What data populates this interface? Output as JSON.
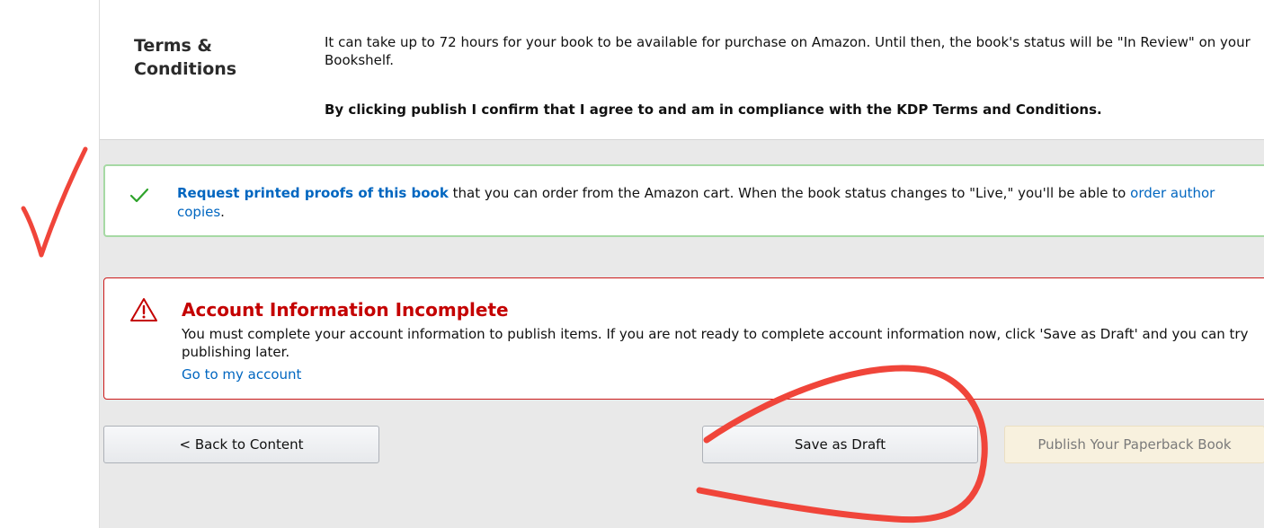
{
  "terms": {
    "heading": "Terms & Conditions",
    "body": "It can take up to 72 hours for your book to be available for purchase on Amazon. Until then, the book's status will be \"In Review\" on your Bookshelf.",
    "confirm": "By clicking publish I confirm that I agree to and am in compliance with the KDP Terms and Conditions."
  },
  "proofs": {
    "icon": "checkmark-icon",
    "link_text": "Request printed proofs of this book",
    "middle_text": " that you can order from the Amazon cart. When the book status changes to \"Live,\" you'll be able to ",
    "author_link_text": "order author copies",
    "end_text": "."
  },
  "account_alert": {
    "icon": "warning-triangle-icon",
    "title": "Account Information Incomplete",
    "body": "You must complete your account information to publish items. If you are not ready to complete account information now, click 'Save as Draft' and you can try publishing later.",
    "link_text": "Go to my account"
  },
  "buttons": {
    "back": "< Back to Content",
    "save_draft": "Save as Draft",
    "publish": "Publish Your Paperback Book"
  },
  "colors": {
    "success_border": "#a6d9a4",
    "error_red": "#c40000",
    "link_blue": "#0066c0",
    "annotation_red": "#f0453a"
  },
  "annotations": {
    "icons": [
      "hand-drawn-checkmark",
      "hand-drawn-circle"
    ]
  }
}
